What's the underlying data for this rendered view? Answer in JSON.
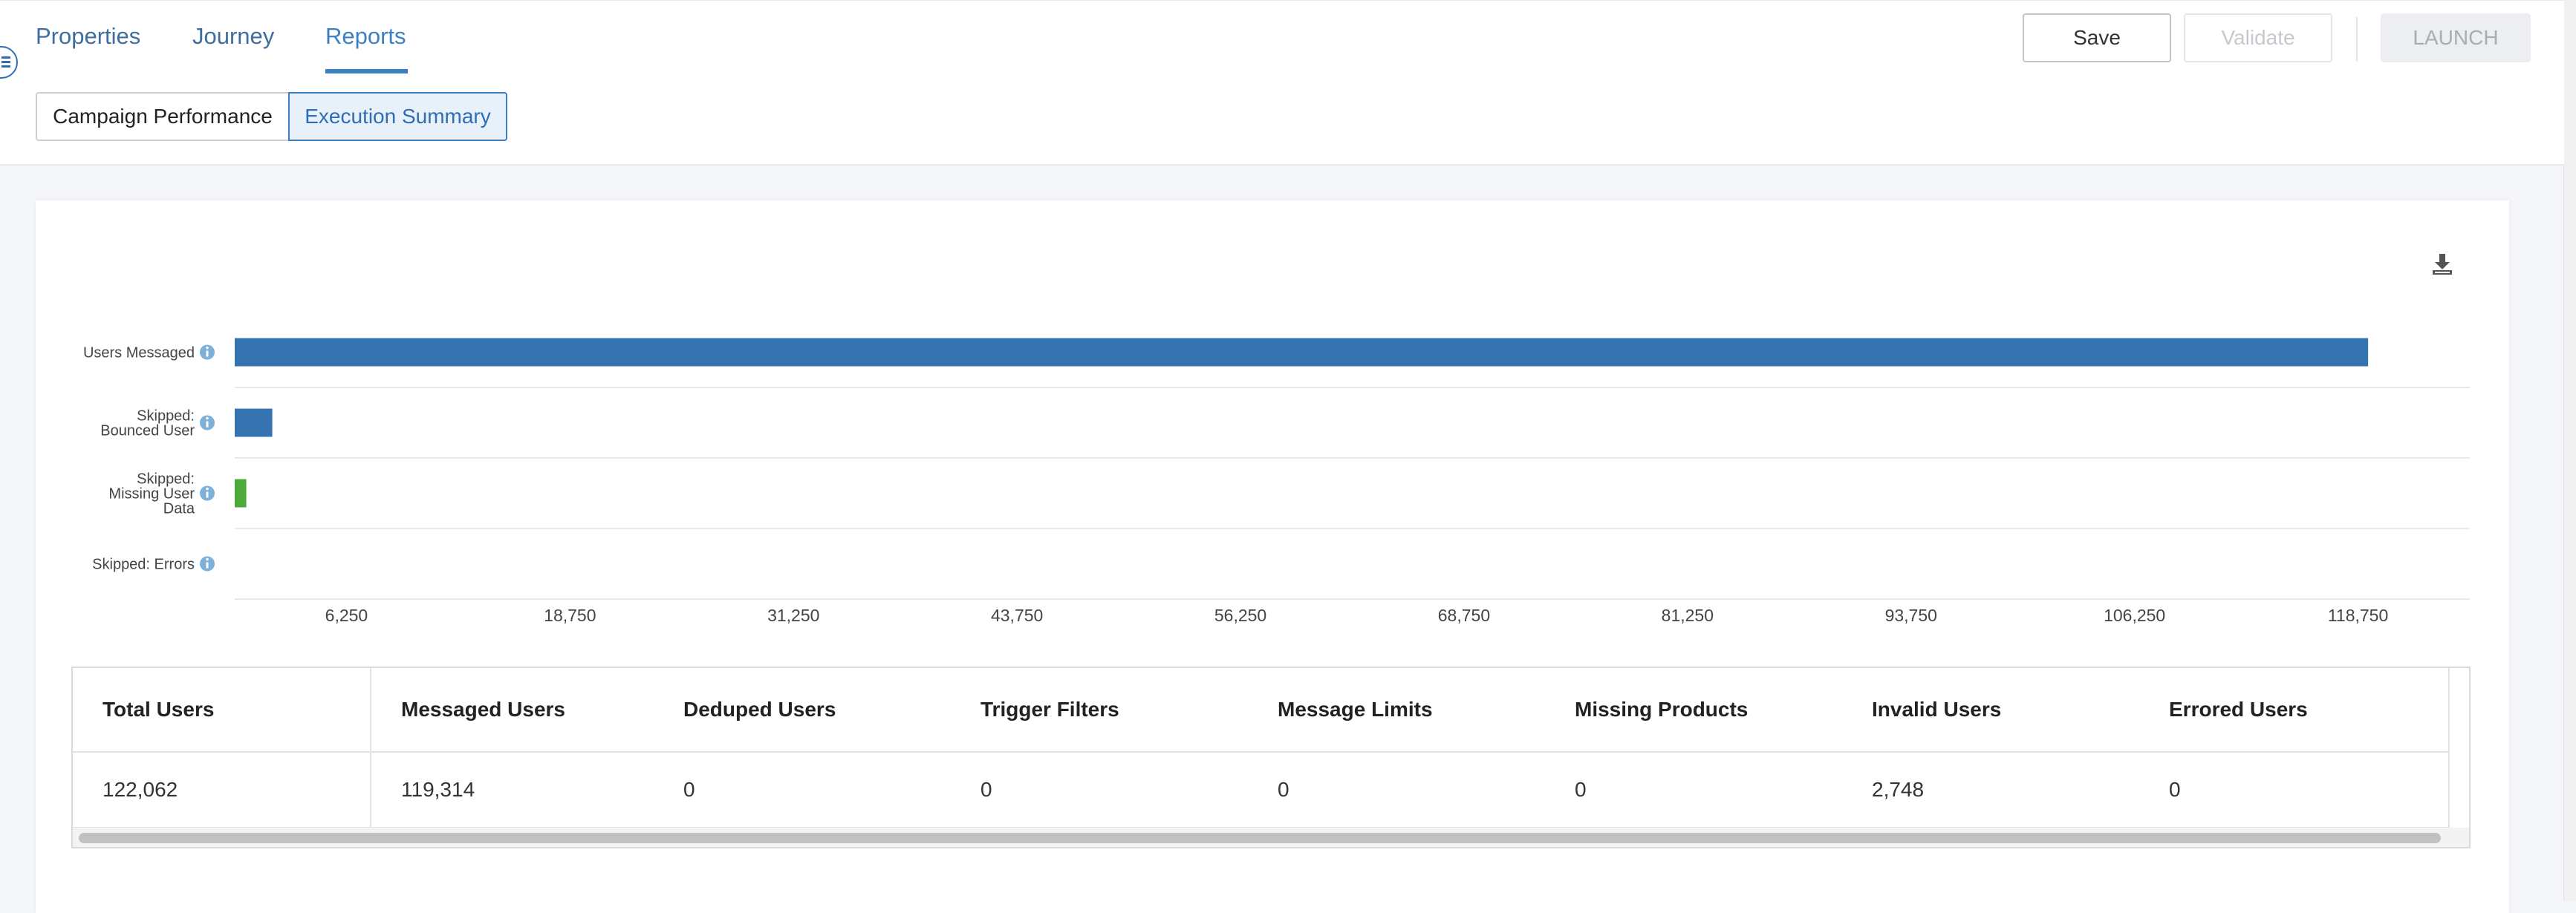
{
  "nav": {
    "tabs": [
      {
        "label": "Properties"
      },
      {
        "label": "Journey"
      },
      {
        "label": "Reports"
      }
    ],
    "active_tab": "Reports"
  },
  "toolbar": {
    "save_label": "Save",
    "validate_label": "Validate",
    "launch_label": "LAUNCH"
  },
  "subtabs": [
    {
      "label": "Campaign Performance"
    },
    {
      "label": "Execution Summary"
    }
  ],
  "active_subtab": "Execution Summary",
  "download_icon": "download-icon",
  "colors": {
    "accent": "#3b7fc4",
    "bar_blue": "#3574b0",
    "bar_green": "#4ea93b"
  },
  "chart_data": {
    "type": "bar",
    "orientation": "horizontal",
    "categories": [
      [
        "Users Messaged"
      ],
      [
        "Skipped:",
        "Bounced User"
      ],
      [
        "Skipped:",
        "Missing User",
        "Data"
      ],
      [
        "Skipped: Errors"
      ]
    ],
    "values": [
      119314,
      2100,
      648,
      0
    ],
    "bar_colors": [
      "#3574b0",
      "#3574b0",
      "#4ea93b",
      "#3574b0"
    ],
    "info_icon": "info-icon",
    "x_ticks": [
      "6,250",
      "18,750",
      "31,250",
      "43,750",
      "56,250",
      "68,750",
      "81,250",
      "93,750",
      "106,250",
      "118,750"
    ],
    "x_tick_values": [
      6250,
      18750,
      31250,
      43750,
      56250,
      68750,
      81250,
      93750,
      106250,
      118750
    ],
    "xlim": [
      0,
      125000
    ],
    "grid": true
  },
  "table": {
    "headers": [
      "Total Users",
      "Messaged Users",
      "Deduped Users",
      "Trigger Filters",
      "Message Limits",
      "Missing Products",
      "Invalid Users",
      "Errored Users"
    ],
    "row": [
      "122,062",
      "119,314",
      "0",
      "0",
      "0",
      "0",
      "2,748",
      "0"
    ]
  }
}
